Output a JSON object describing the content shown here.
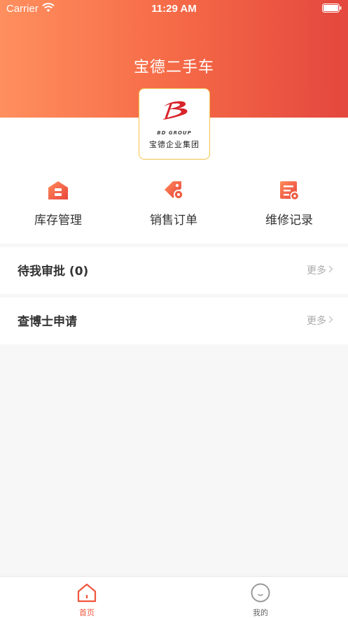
{
  "status_bar": {
    "carrier": "Carrier",
    "time": "11:29 AM"
  },
  "header": {
    "title": "宝德二手车"
  },
  "logo": {
    "en": "BD GROUP",
    "cn": "宝德企业集团"
  },
  "menu": [
    {
      "label": "库存管理",
      "icon": "warehouse-icon"
    },
    {
      "label": "销售订单",
      "icon": "tag-gear-icon"
    },
    {
      "label": "维修记录",
      "icon": "repair-record-icon"
    }
  ],
  "rows": [
    {
      "title": "待我审批 (0)",
      "more": "更多"
    },
    {
      "title": "查博士申请",
      "more": "更多"
    }
  ],
  "tabs": [
    {
      "label": "首页",
      "icon": "home-icon",
      "active": true
    },
    {
      "label": "我的",
      "icon": "smile-icon",
      "active": false
    }
  ],
  "colors": {
    "accent": "#f0553d",
    "header_start": "#ff8f5e",
    "header_end": "#e4473e",
    "inactive": "#999999"
  }
}
